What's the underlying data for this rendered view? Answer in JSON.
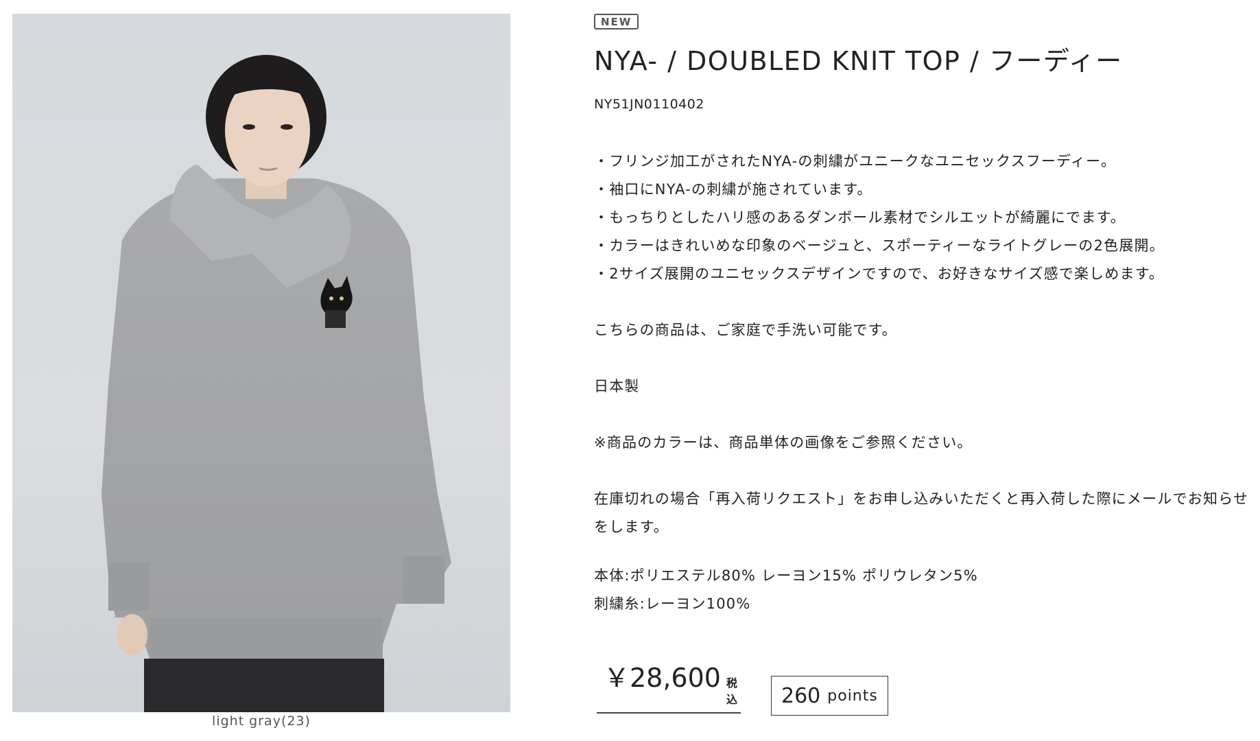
{
  "product": {
    "badge": "NEW",
    "title": "NYA- / DOUBLED KNIT TOP / フーディー",
    "sku": "NY51JN0110402",
    "image_caption": "light gray(23)",
    "bullets": [
      "・フリンジ加工がされたNYA-の刺繍がユニークなユニセックスフーディー。",
      "・袖口にNYA-の刺繍が施されています。",
      "・もっちりとしたハリ感のあるダンボール素材でシルエットが綺麗にでます。",
      "・カラーはきれいめな印象のベージュと、スポーティーなライトグレーの2色展開。",
      "・2サイズ展開のユニセックスデザインですので、お好きなサイズ感で楽しめます。"
    ],
    "care_note": "こちらの商品は、ご家庭で手洗い可能です。",
    "origin": "日本製",
    "color_note": "※商品のカラーは、商品単体の画像をご参照ください。",
    "restock_note": "在庫切れの場合「再入荷リクエスト」をお申し込みいただくと再入荷した際にメールでお知らせをします。",
    "materials": [
      "本体:ポリエステル80% レーヨン15% ポリウレタン5%",
      "刺繍糸:レーヨン100%"
    ],
    "price": {
      "amount": "￥28,600",
      "tax_label": "税込"
    },
    "points": {
      "value": "260",
      "unit": "points"
    }
  }
}
